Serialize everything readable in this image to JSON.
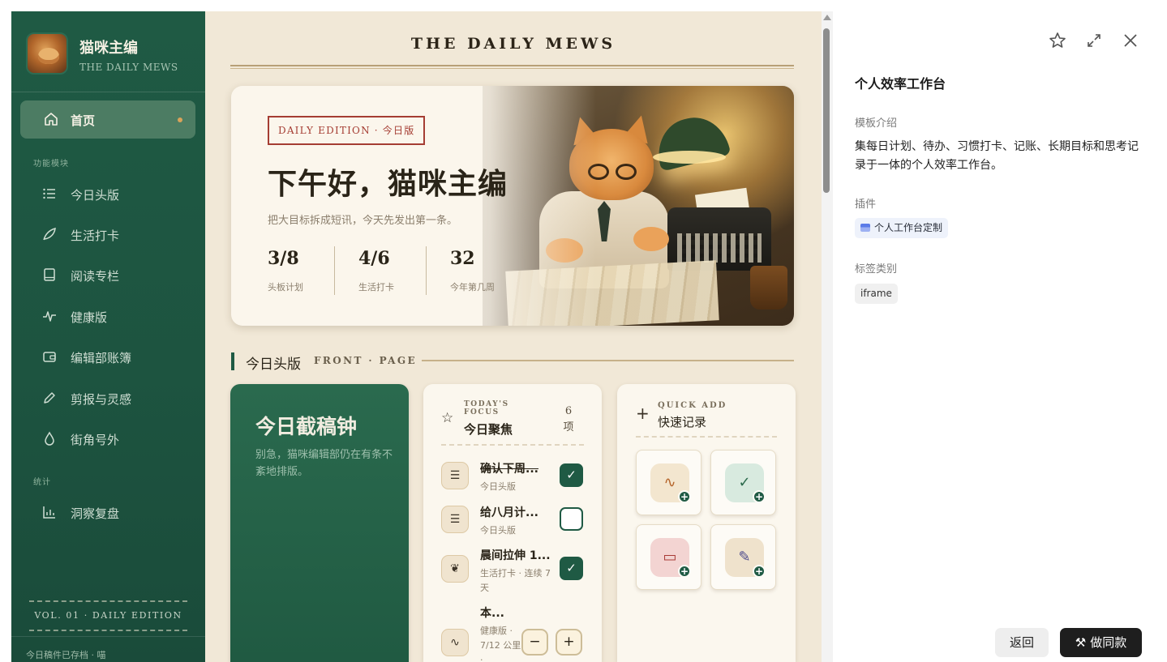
{
  "app": {
    "brand_title": "猫咪主编",
    "brand_subtitle": "THE DAILY MEWS",
    "masthead": "THE DAILY MEWS"
  },
  "sidebar": {
    "home_label": "首页",
    "section_modules": "功能模块",
    "items": [
      {
        "label": "今日头版",
        "icon": "list-icon"
      },
      {
        "label": "生活打卡",
        "icon": "leaf-icon"
      },
      {
        "label": "阅读专栏",
        "icon": "book-icon"
      },
      {
        "label": "健康版",
        "icon": "pulse-icon"
      },
      {
        "label": "编辑部账簿",
        "icon": "wallet-icon"
      },
      {
        "label": "剪报与灵感",
        "icon": "pencil-icon"
      },
      {
        "label": "街角号外",
        "icon": "drop-icon"
      }
    ],
    "section_stats": "统计",
    "stats_item": {
      "label": "洞察复盘",
      "icon": "bar-chart-icon"
    },
    "footer_vol": "VOL. 01 · DAILY EDITION",
    "footer_archive": "今日稿件已存档 · 喵"
  },
  "hero": {
    "badge": "DAILY EDITION · 今日版",
    "greeting": "下午好，猫咪主编",
    "subtitle": "把大目标拆成短讯，今天先发出第一条。",
    "stats": [
      {
        "value": "3/8",
        "caption": "头板计划"
      },
      {
        "value": "4/6",
        "caption": "生活打卡"
      },
      {
        "value": "32",
        "caption": "今年第几周"
      }
    ]
  },
  "section": {
    "title": "今日头版",
    "title_en": "FRONT · PAGE"
  },
  "deadline": {
    "title": "今日截稿钟",
    "subtitle": "别急，猫咪编辑部仍在有条不紊地排版。"
  },
  "focus": {
    "title_en": "TODAY'S FOCUS",
    "title": "今日聚焦",
    "count_num": "6",
    "count_unit": "项",
    "tasks": [
      {
        "title": "确认下周...",
        "meta": "今日头版",
        "icon": "list-icon",
        "done": true
      },
      {
        "title": "给八月计...",
        "meta": "今日头版",
        "icon": "list-icon",
        "done": false
      },
      {
        "title": "晨间拉伸 1...",
        "meta": "生活打卡 · 连续 7 天",
        "icon": "leaf-icon",
        "done": true
      },
      {
        "title": "本...",
        "meta": "健康版 · 7/12 公里 ·",
        "icon": "pulse-icon",
        "stepper": true
      }
    ],
    "minus": "−",
    "plus": "+"
  },
  "quick_add": {
    "title_en": "QUICK ADD",
    "title": "快速记录",
    "tiles": [
      {
        "icon": "pulse-icon",
        "bg": "#f3e6cf",
        "color": "#b5642a"
      },
      {
        "icon": "check-icon",
        "bg": "#d8eadf",
        "color": "#2c6a4c"
      },
      {
        "icon": "wallet-icon",
        "bg": "#f3d4d2",
        "color": "#a83a36"
      },
      {
        "icon": "pencil-icon",
        "bg": "#efe2cc",
        "color": "#4c4a8c"
      }
    ]
  },
  "panel": {
    "title": "个人效率工作台",
    "intro_label": "模板介绍",
    "description": "集每日计划、待办、习惯打卡、记账、长期目标和思考记录于一体的个人效率工作台。",
    "plugin_label": "插件",
    "plugin_name": "个人工作台定制",
    "tag_label": "标签类别",
    "tag": "iframe",
    "back_button": "返回",
    "make_button": "做同款"
  },
  "colors": {
    "sidebar_green": "#1f5a44",
    "paper": "#f1e8d7",
    "accent_red": "#a53d33"
  }
}
